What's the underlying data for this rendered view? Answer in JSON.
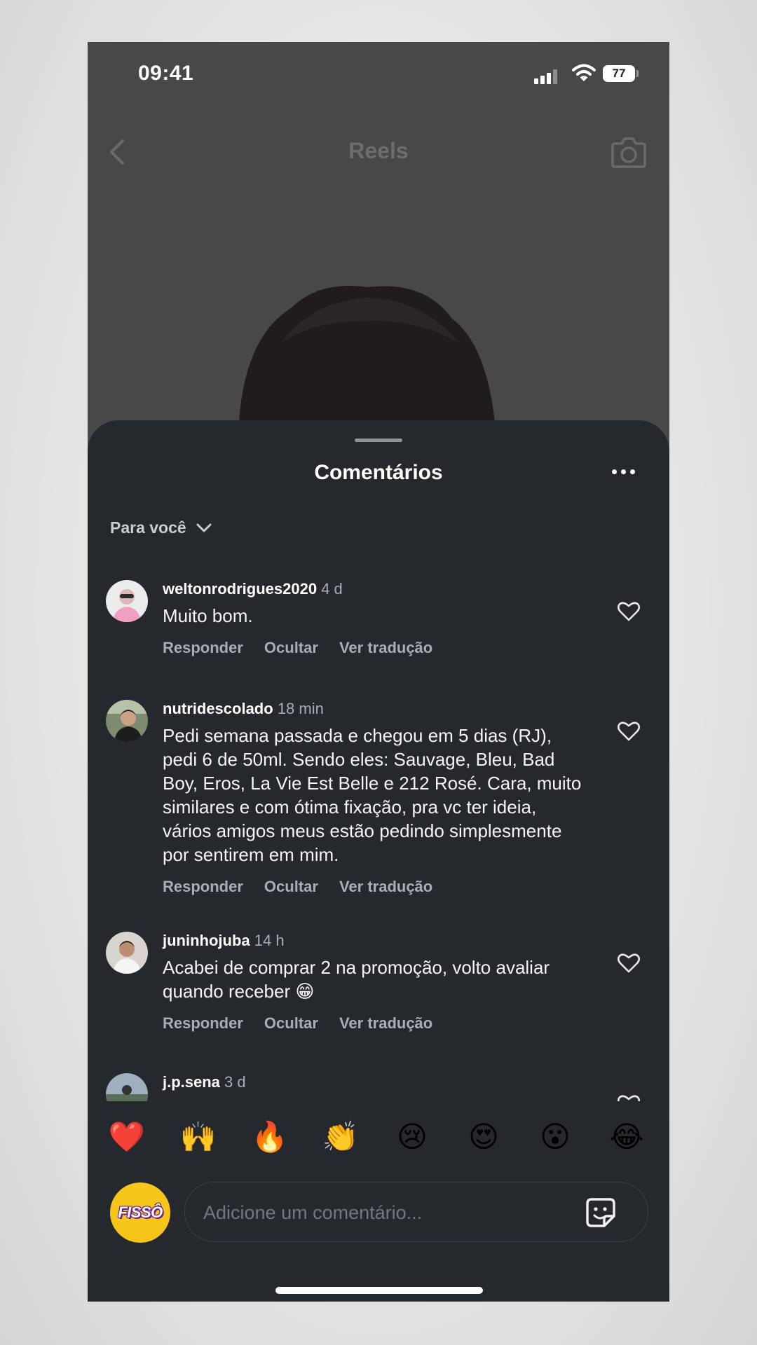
{
  "status_bar": {
    "time": "09:41",
    "battery": "77"
  },
  "header": {
    "title": "Reels"
  },
  "sheet": {
    "title": "Comentários",
    "filter_label": "Para você"
  },
  "actions": {
    "reply": "Responder",
    "hide": "Ocultar",
    "translate": "Ver tradução"
  },
  "comments": [
    {
      "user": "weltonrodrigues2020",
      "time": "4 d",
      "text": "Muito bom."
    },
    {
      "user": "nutridescolado",
      "time": "18 min",
      "text": "Pedi semana passada e chegou em 5 dias (RJ), pedi 6 de 50ml. Sendo eles: Sauvage, Bleu, Bad Boy, Eros, La Vie Est Belle e 212 Rosé. Cara, muito similares e com ótima fixação, pra vc ter ideia, vários amigos meus estão pedindo simplesmente por sentirem em mim."
    },
    {
      "user": "juninhojuba",
      "time": "14 h",
      "text": "Acabei de comprar 2 na promoção, volto avaliar quando receber 😁"
    },
    {
      "user": "j.p.sena",
      "time": "3 d",
      "text": ""
    }
  ],
  "emoji_reactions": [
    "❤️",
    "🙌",
    "🔥",
    "👏",
    "😢",
    "😍",
    "😮",
    "😂"
  ],
  "composer": {
    "avatar_text": "FISSÔ",
    "placeholder": "Adicione um comentário..."
  },
  "colors": {
    "sheet_bg": "#25282d",
    "accent_yellow": "#f6c51a"
  }
}
